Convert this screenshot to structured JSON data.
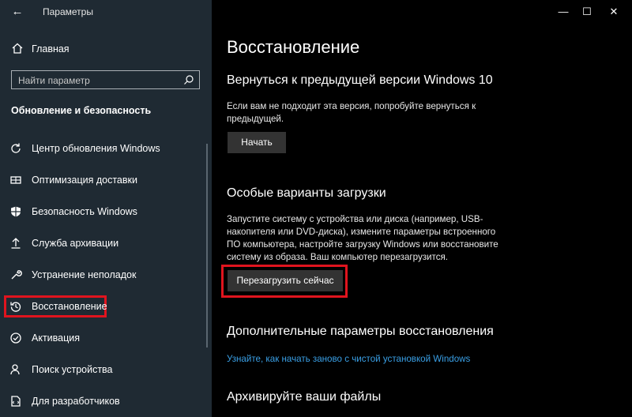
{
  "window": {
    "title": "Параметры",
    "minimize": "—",
    "maximize": "☐",
    "close": "✕"
  },
  "sidebar": {
    "home_label": "Главная",
    "search_placeholder": "Найти параметр",
    "section_title": "Обновление и безопасность",
    "items": [
      {
        "label": "Центр обновления Windows",
        "icon": "refresh-icon"
      },
      {
        "label": "Оптимизация доставки",
        "icon": "delivery-icon"
      },
      {
        "label": "Безопасность Windows",
        "icon": "shield-icon"
      },
      {
        "label": "Служба архивации",
        "icon": "upload-icon"
      },
      {
        "label": "Устранение неполадок",
        "icon": "wrench-icon"
      },
      {
        "label": "Восстановление",
        "icon": "history-icon",
        "selected": true
      },
      {
        "label": "Активация",
        "icon": "check-circle-icon"
      },
      {
        "label": "Поиск устройства",
        "icon": "person-search-icon"
      },
      {
        "label": "Для разработчиков",
        "icon": "developer-icon"
      }
    ]
  },
  "main": {
    "title": "Восстановление",
    "rollback": {
      "heading": "Вернуться к предыдущей версии Windows 10",
      "text": "Если вам не подходит эта версия, попробуйте вернуться к предыдущей.",
      "button": "Начать"
    },
    "special_boot": {
      "heading": "Особые варианты загрузки",
      "text": "Запустите систему с устройства или диска (например, USB-накопителя или DVD-диска), измените параметры встроенного ПО компьютера, настройте загрузку Windows или восстановите систему из образа. Ваш компьютер перезагрузится.",
      "button": "Перезагрузить сейчас"
    },
    "advanced": {
      "heading": "Дополнительные параметры восстановления",
      "link": "Узнайте, как начать заново с чистой установкой Windows"
    },
    "archive": {
      "heading": "Архивируйте ваши файлы"
    }
  },
  "colors": {
    "sidebar_bg": "#1f2a33",
    "content_bg": "#000000",
    "accent": "#2c9ad6",
    "highlight": "#e0141e",
    "link": "#3aa0e6"
  }
}
